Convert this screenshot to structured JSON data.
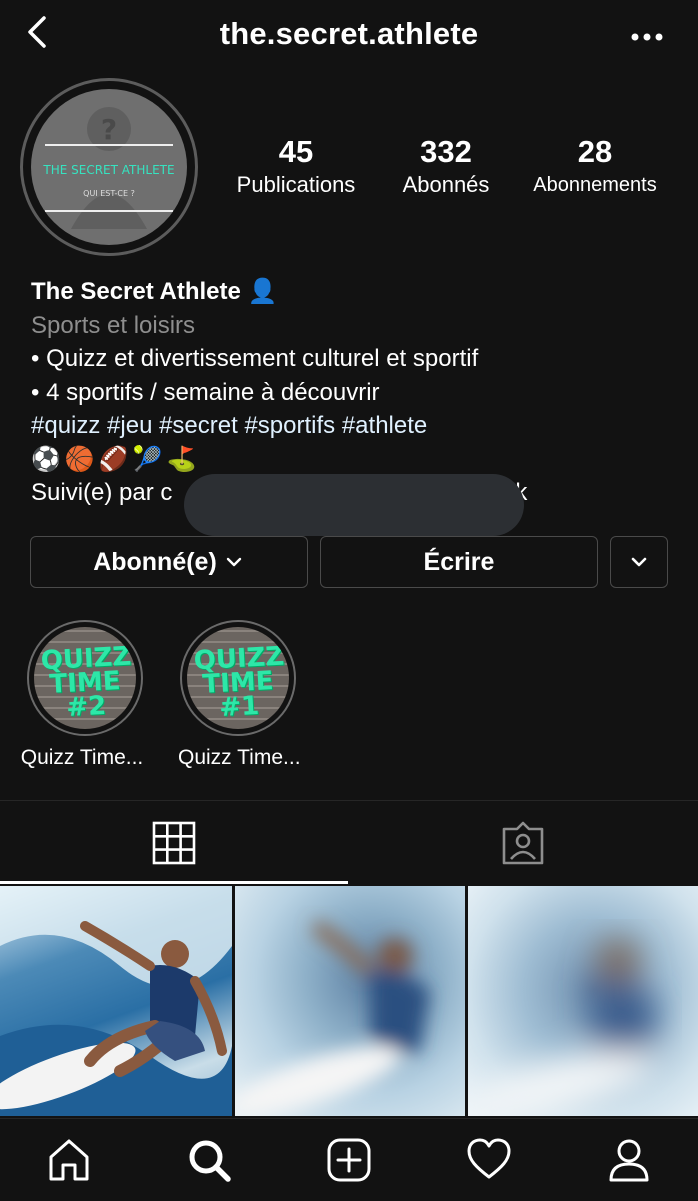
{
  "header": {
    "username": "the.secret.athlete"
  },
  "avatar": {
    "line1": "THE SECRET ATHLETE",
    "line2": "QUI EST-CE ?"
  },
  "stats": [
    {
      "value": "45",
      "label": "Publications"
    },
    {
      "value": "332",
      "label": "Abonnés"
    },
    {
      "value": "28",
      "label": "Abonnements"
    }
  ],
  "bio": {
    "name": "The Secret Athlete 👤",
    "category": "Sports et loisirs",
    "line1": "• Quizz et divertissement culturel et sportif",
    "line2": "• 4 sportifs / semaine à découvrir",
    "hashtags": "#quizz #jeu #secret #sportifs #athlete",
    "emojis": [
      "⚽",
      "🏀",
      "🏈",
      "🎾",
      "⛳"
    ],
    "followed_by": "Suivi(e) par c",
    "followed_by_tail": "k"
  },
  "buttons": {
    "follow": "Abonné(e)",
    "message": "Écrire"
  },
  "highlights": [
    {
      "label": "Quizz Time...",
      "art": "QUIZZ TIME #2"
    },
    {
      "label": "Quizz Time...",
      "art": "QUIZZ TIME #1"
    }
  ],
  "colors": {
    "background": "#121212",
    "link": "#e0f1ff",
    "muted": "#8e8e8e",
    "border": "#4a4a4a"
  }
}
